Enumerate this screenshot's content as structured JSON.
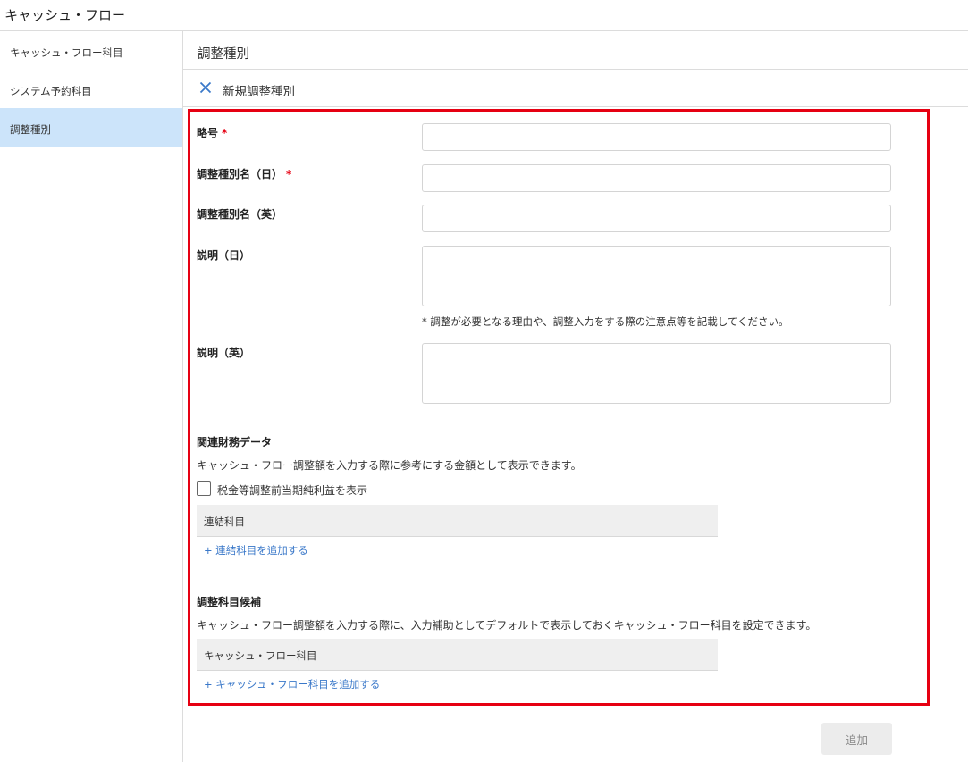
{
  "app": {
    "title": "キャッシュ・フロー"
  },
  "sidebar": {
    "items": [
      {
        "label": "キャッシュ・フロー科目",
        "active": false
      },
      {
        "label": "システム予約科目",
        "active": false
      },
      {
        "label": "調整種別",
        "active": true
      }
    ]
  },
  "page": {
    "title": "調整種別"
  },
  "subheader": {
    "title": "新規調整種別",
    "close_icon": "close-icon"
  },
  "form": {
    "abbreviation_label": "略号",
    "name_ja_label": "調整種別名（日）",
    "name_en_label": "調整種別名（英）",
    "desc_ja_label": "説明（日）",
    "desc_ja_hint": "* 調整が必要となる理由や、調整入力をする際の注意点等を記載してください。",
    "desc_en_label": "説明（英）",
    "required_mark": "*",
    "abbreviation_value": "",
    "name_ja_value": "",
    "name_en_value": ""
  },
  "related": {
    "title": "関連財務データ",
    "description": "キャッシュ・フロー調整額を入力する際に参考にする金額として表示できます。",
    "checkbox_label": "税金等調整前当期純利益を表示",
    "checkbox_checked": false,
    "table_header": "連結科目",
    "add_link": "+ 連結科目を追加する"
  },
  "candidates": {
    "title": "調整科目候補",
    "description": "キャッシュ・フロー調整額を入力する際に、入力補助としてデフォルトで表示しておくキャッシュ・フロー科目を設定できます。",
    "table_header": "キャッシュ・フロー科目",
    "add_link": "+ キャッシュ・フロー科目を追加する"
  },
  "actions": {
    "submit_label": "追加"
  },
  "colors": {
    "highlight": "#e60012",
    "active_bg": "#cce4fa",
    "link": "#3a78c9",
    "icon": "#3a78c9"
  }
}
